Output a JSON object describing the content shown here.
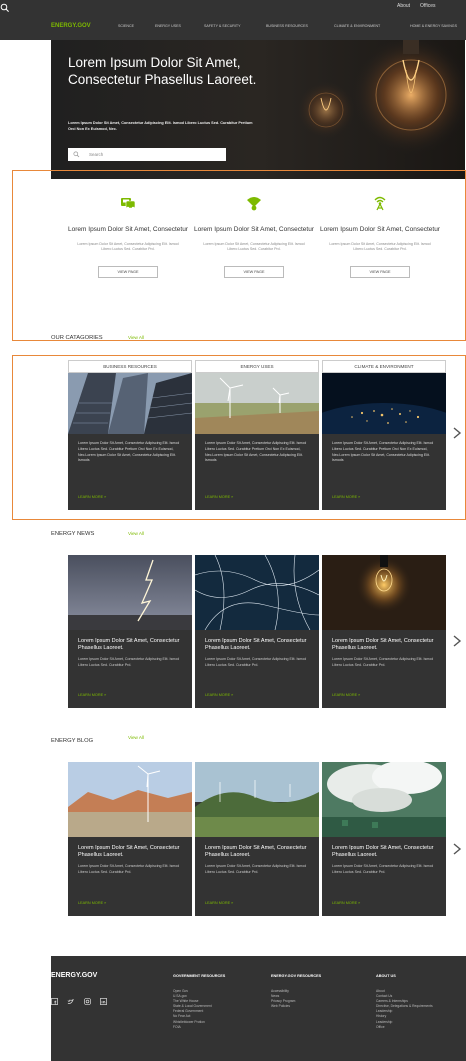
{
  "utility": {
    "about": "About",
    "offices": "Offices"
  },
  "nav": {
    "logo": "ENERGY.GOV",
    "items": [
      "SCIENCE",
      "ENERGY USES",
      "SAFETY & SECURITY",
      "BUSINESS RESOURCES",
      "CLIMATE & ENVIRONMENT",
      "HOME & ENERGY SAVINGS"
    ]
  },
  "hero": {
    "title": "Lorem Ipsum Dolor Sit Amet, Consectetur Phasellus Laoreet.",
    "text": "Lorem Ipsum Dolor Sit Amet, Consectetur Adipiscing Elit. Ismod Libero Luctus Sed. Curabitur Pretium Orci Non Ex Euismod, Nec.",
    "search_placeholder": "Search"
  },
  "features": [
    {
      "icon": "car-icon",
      "title": "Lorem Ipsum Dolor Sit Amet, Consectetur",
      "text": "Lorem Ipsum Dolor Sit Amet, Consectetur Adipiscing Elit. Ismod Libero Luctus Sed. Curabitur Prd.",
      "button": "VIEW PAGE"
    },
    {
      "icon": "wifi-icon",
      "title": "Lorem Ipsum Dolor Sit Amet, Consectetur",
      "text": "Lorem Ipsum Dolor Sit Amet, Consectetur Adipiscing Elit. Ismod Libero Luctus Sed. Curabitur Prd.",
      "button": "VIEW PAGE"
    },
    {
      "icon": "antenna-icon",
      "title": "Lorem Ipsum Dolor Sit Amet, Consectetur",
      "text": "Lorem Ipsum Dolor Sit Amet, Consectetur Adipiscing Elit. Ismod Libero Luctus Sed. Curabitur Prd.",
      "button": "VIEW PAGE"
    }
  ],
  "categories": {
    "title": "OUR CATAGORIES",
    "view_all": "View All",
    "items": [
      {
        "head": "BUSINESS RESOURCES",
        "text": "Lorem Ipsum Dolor Sit Amet, Consectetur Adipiscing Elit. Ismod Libero Luctus Sed. Curabitur Pretium Orci Non Ex Euismod, Nec.Lorem Ipsum Dolor Sit Amet, Consectetur Adipiscing Elit. Ismods",
        "link": "LEARN MORE »"
      },
      {
        "head": "ENERGY USES",
        "text": "Lorem Ipsum Dolor Sit Amet, Consectetur Adipiscing Elit. Ismod Libero Luctus Sed. Curabitur Pretium Orci Non Ex Euismod, Nec.Lorem Ipsum Dolor Sit Amet, Consectetur Adipiscing Elit. Ismods",
        "link": "LEARN MORE »"
      },
      {
        "head": "CLIMATE & ENVIRONMENT",
        "text": "Lorem Ipsum Dolor Sit Amet, Consectetur Adipiscing Elit. Ismod Libero Luctus Sed. Curabitur Pretium Orci Non Ex Euismod, Nec.Lorem Ipsum Dolor Sit Amet, Consectetur Adipiscing Elit. Ismods",
        "link": "LEARN MORE »"
      }
    ]
  },
  "news": {
    "title": "ENERGY NEWS",
    "view_all": "View All",
    "items": [
      {
        "title": "Lorem Ipsum Dolor Sit Amet, Consectetur  Phasellus Laoreet.",
        "text": "Lorem Ipsum Dolor Sit Amet, Consectetur Adipiscing Elit. Ismod Libero Luctus Sed. Curabitur Prd.",
        "link": "LEARN MORE »"
      },
      {
        "title": "Lorem Ipsum Dolor Sit Amet, Consectetur  Phasellus Laoreet.",
        "text": "Lorem Ipsum Dolor Sit Amet, Consectetur Adipiscing Elit. Ismod Libero Luctus Sed. Curabitur Prd.",
        "link": "LEARN MORE »"
      },
      {
        "title": "Lorem Ipsum Dolor Sit Amet, Consectetur  Phasellus Laoreet.",
        "text": "Lorem Ipsum Dolor Sit Amet, Consectetur Adipiscing Elit. Ismod Libero Luctus Sed. Curabitur Prd.",
        "link": "LEARN MORE »"
      }
    ]
  },
  "blog": {
    "title": "ENERGY BLOG",
    "view_all": "View All",
    "items": [
      {
        "title": "Lorem Ipsum Dolor Sit Amet, Consectetur  Phasellus Laoreet.",
        "text": "Lorem Ipsum Dolor Sit Amet, Consectetur Adipiscing Elit. Ismod Libero Luctus Sed. Curabitur Prd.",
        "link": "LEARN MORE »"
      },
      {
        "title": "Lorem Ipsum Dolor Sit Amet, Consectetur  Phasellus Laoreet.",
        "text": "Lorem Ipsum Dolor Sit Amet, Consectetur Adipiscing Elit. Ismod Libero Luctus Sed. Curabitur Prd.",
        "link": "LEARN MORE »"
      },
      {
        "title": "Lorem Ipsum Dolor Sit Amet, Consectetur  Phasellus Laoreet.",
        "text": "Lorem Ipsum Dolor Sit Amet, Consectetur Adipiscing Elit. Ismod Libero Luctus Sed. Curabitur Prd.",
        "link": "LEARN MORE »"
      }
    ]
  },
  "footer": {
    "logo": "ENERGY.GOV",
    "socials": [
      "facebook-icon",
      "twitter-icon",
      "instagram-icon",
      "linkedin-icon"
    ],
    "columns": [
      {
        "title": "GOVERNMENT RESOURCES",
        "links": [
          "Open Gov",
          "U.SA.gov",
          "The White House",
          "State & Local Government",
          "Federal Government",
          "No Fear Act",
          "Whistleblower Protion",
          "FOIA"
        ]
      },
      {
        "title": "ENERGY.GOV RESOURCES",
        "links": [
          "Accessibility",
          "News",
          "Privacy Program",
          "Web Policies"
        ]
      },
      {
        "title": "ABOUT US",
        "links": [
          "About",
          "Contact Us",
          "Careers & Internships",
          "Directive, Delegations & Requirements",
          "Leadership",
          "History",
          "Leadership",
          "Office"
        ]
      }
    ]
  },
  "colors": {
    "accent": "#7dba00",
    "dark": "#333333",
    "highlight": "#e8883a"
  }
}
